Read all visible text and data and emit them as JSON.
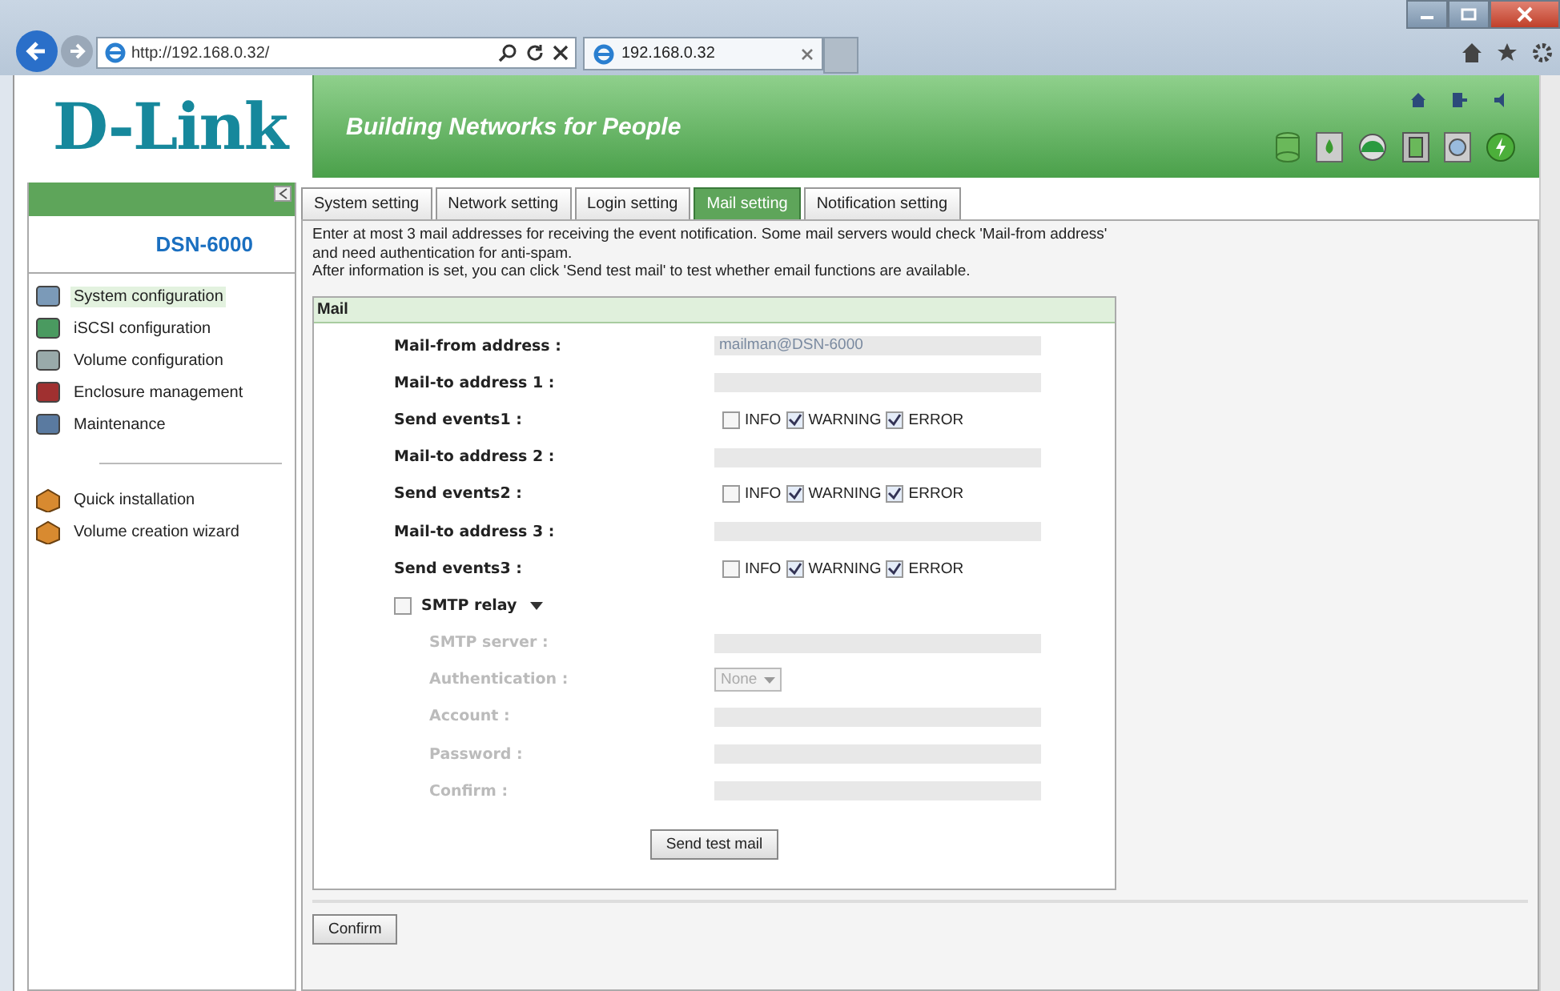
{
  "browser": {
    "address": "http://192.168.0.32/",
    "tab": "192.168.0.32"
  },
  "header": {
    "logo": "D-Link",
    "slogan": "Building Networks for People"
  },
  "sidebar": {
    "model": "DSN-6000",
    "items": [
      {
        "label": "System configuration",
        "selected": true
      },
      {
        "label": "iSCSI configuration",
        "selected": false
      },
      {
        "label": "Volume configuration",
        "selected": false
      },
      {
        "label": "Enclosure management",
        "selected": false
      },
      {
        "label": "Maintenance",
        "selected": false
      }
    ],
    "wizards": [
      {
        "label": "Quick installation"
      },
      {
        "label": "Volume creation wizard"
      }
    ]
  },
  "tabs": [
    {
      "label": "System setting",
      "selected": false
    },
    {
      "label": "Network setting",
      "selected": false
    },
    {
      "label": "Login setting",
      "selected": false
    },
    {
      "label": "Mail setting",
      "selected": true
    },
    {
      "label": "Notification setting",
      "selected": false
    }
  ],
  "intro": [
    "Enter at most 3 mail addresses for receiving the event notification. Some mail servers would check 'Mail-from address' and need authentication for anti-spam.",
    "After information is set, you can click 'Send test mail' to test whether email functions are available."
  ],
  "panel": {
    "title": "Mail",
    "rows": [
      {
        "kind": "field",
        "label": "Mail-from address :",
        "value": "mailman@DSN-6000",
        "disabled": false
      },
      {
        "kind": "field",
        "label": "Mail-to address 1 :",
        "disabled": false
      },
      {
        "kind": "events",
        "label": "Send events1 :",
        "options": [
          {
            "label": "INFO",
            "checked": false
          },
          {
            "label": "WARNING",
            "checked": true
          },
          {
            "label": "ERROR",
            "checked": true
          }
        ]
      },
      {
        "kind": "field",
        "label": "Mail-to address 2 :",
        "disabled": false
      },
      {
        "kind": "events",
        "label": "Send events2 :",
        "options": [
          {
            "label": "INFO",
            "checked": false
          },
          {
            "label": "WARNING",
            "checked": true
          },
          {
            "label": "ERROR",
            "checked": true
          }
        ]
      },
      {
        "kind": "field",
        "label": "Mail-to address 3 :",
        "disabled": false
      },
      {
        "kind": "events",
        "label": "Send events3 :",
        "options": [
          {
            "label": "INFO",
            "checked": false
          },
          {
            "label": "WARNING",
            "checked": true
          },
          {
            "label": "ERROR",
            "checked": true
          }
        ]
      },
      {
        "kind": "toggle",
        "label": "SMTP relay",
        "checked": false
      },
      {
        "kind": "field",
        "label": "SMTP server :",
        "disabled": true
      },
      {
        "kind": "select",
        "label": "Authentication :",
        "value": "None",
        "disabled": true
      },
      {
        "kind": "field",
        "label": "Account :",
        "disabled": true
      },
      {
        "kind": "field",
        "label": "Password :",
        "disabled": true
      },
      {
        "kind": "field",
        "label": "Confirm :",
        "disabled": true
      }
    ],
    "test_button": "Send test mail"
  },
  "confirm_button": "Confirm"
}
